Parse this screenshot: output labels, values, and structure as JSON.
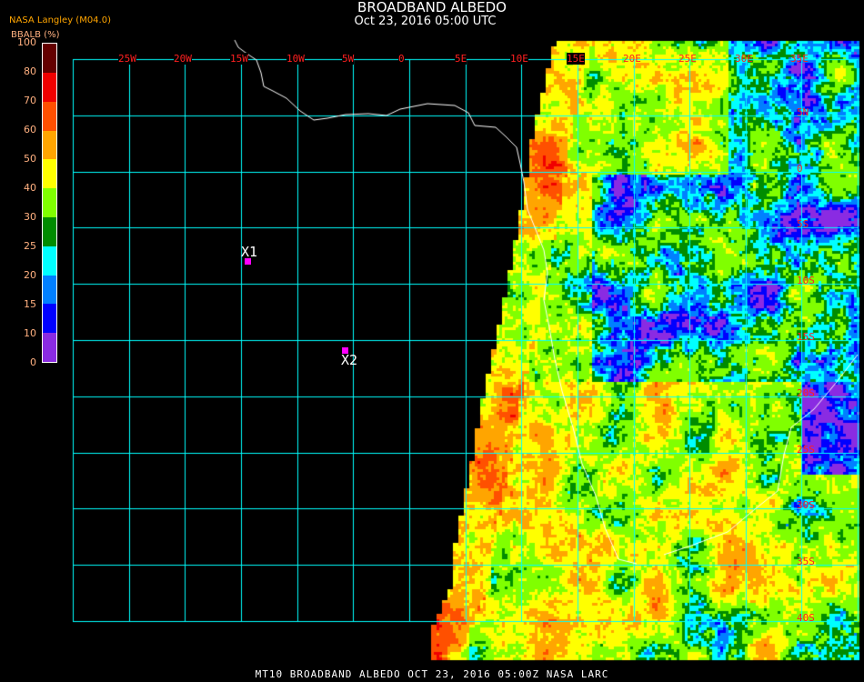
{
  "header": {
    "title": "BROADBAND ALBEDO",
    "subtitle": "Oct 23, 2016 05:00 UTC",
    "source": "NASA Langley (M04.0)"
  },
  "legend": {
    "label": "BBALB (%)",
    "ticks": [
      "0",
      "10",
      "15",
      "20",
      "25",
      "30",
      "40",
      "50",
      "60",
      "70",
      "80",
      "100"
    ],
    "colors": [
      "#8a2be2",
      "#0000ff",
      "#0080ff",
      "#00ffff",
      "#008c00",
      "#80ff00",
      "#ffff00",
      "#ffa500",
      "#ff5000",
      "#f00000",
      "#640000"
    ]
  },
  "map": {
    "lon_labels": [
      "25W",
      "20W",
      "15W",
      "10W",
      "5W",
      "0",
      "5E",
      "10E",
      "15E",
      "20E",
      "25E",
      "30E",
      "35E"
    ],
    "lat_labels": [
      "5N",
      "0",
      "5S",
      "10S",
      "15S",
      "20S",
      "25S",
      "30S",
      "35S",
      "40S"
    ],
    "grid_color": "#00ffff",
    "markers": [
      {
        "label": "X1",
        "color": "#ff00ff"
      },
      {
        "label": "X2",
        "color": "#ff00ff"
      }
    ]
  },
  "footer": "MT10  BROADBAND ALBEDO   OCT 23, 2016 05:00Z   NASA LARC"
}
